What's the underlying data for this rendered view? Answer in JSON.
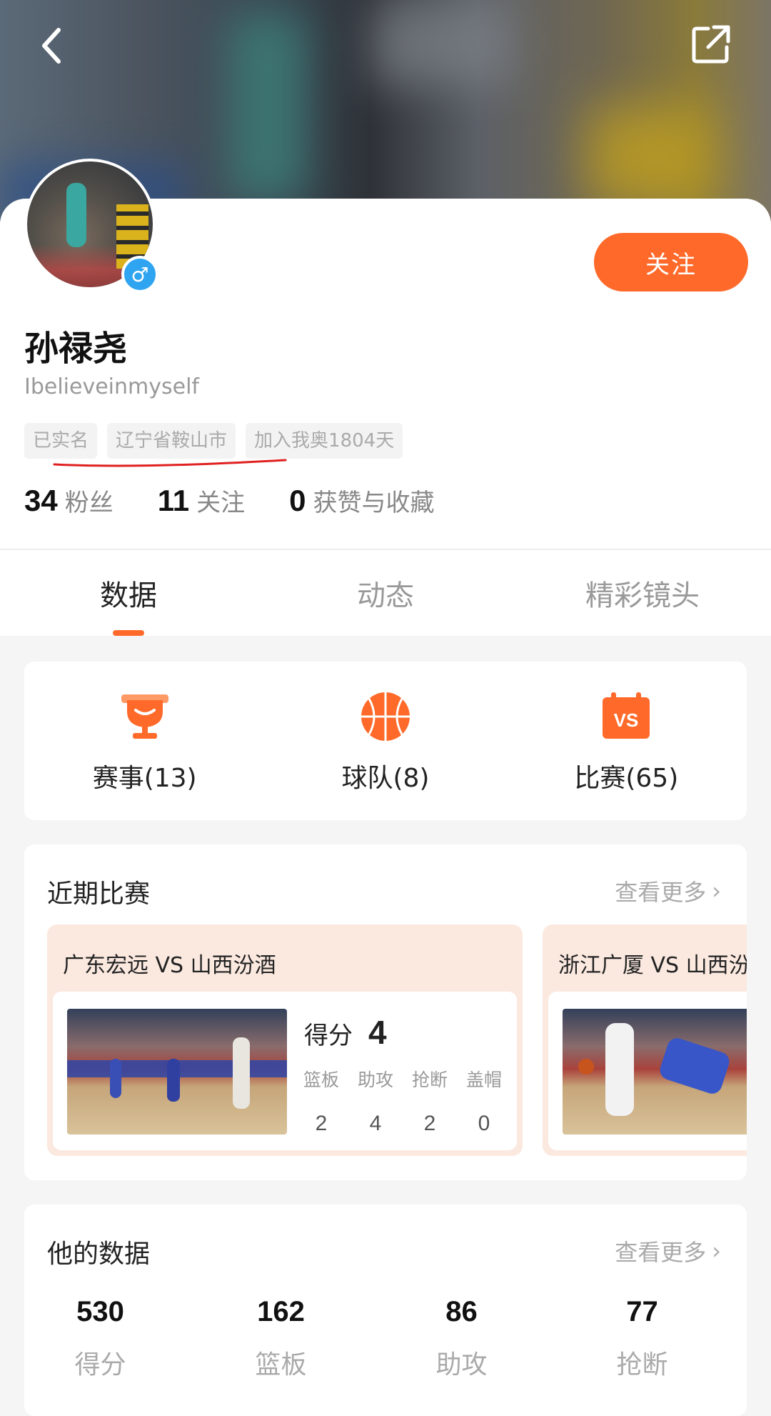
{
  "header": {
    "back_icon": "chevron-left-icon",
    "share_icon": "share-icon"
  },
  "profile": {
    "name": "孙禄尧",
    "handle": "Ibelieveinmyself",
    "gender_symbol": "♂",
    "follow_label": "关注",
    "tags": [
      "已实名",
      "辽宁省鞍山市",
      "加入我奥1804天"
    ],
    "stats": [
      {
        "value": "34",
        "label": "粉丝"
      },
      {
        "value": "11",
        "label": "关注"
      },
      {
        "value": "0",
        "label": "获赞与收藏"
      }
    ]
  },
  "tabs": [
    {
      "label": "数据",
      "active": true
    },
    {
      "label": "动态",
      "active": false
    },
    {
      "label": "精彩镜头",
      "active": false
    }
  ],
  "quick_links": [
    {
      "label": "赛事(13)",
      "icon": "trophy-icon"
    },
    {
      "label": "球队(8)",
      "icon": "basketball-icon"
    },
    {
      "label": "比赛(65)",
      "icon": "vs-calendar-icon"
    }
  ],
  "recent": {
    "title": "近期比赛",
    "see_more": "查看更多",
    "matches": [
      {
        "title": "广东宏远 VS 山西汾酒",
        "score_label": "得分",
        "score": "4",
        "stats": [
          {
            "label": "篮板",
            "value": "2"
          },
          {
            "label": "助攻",
            "value": "4"
          },
          {
            "label": "抢断",
            "value": "2"
          },
          {
            "label": "盖帽",
            "value": "0"
          }
        ]
      },
      {
        "title": "浙江广厦 VS 山西汾酒"
      }
    ]
  },
  "his_data": {
    "title": "他的数据",
    "see_more": "查看更多",
    "items": [
      {
        "value": "530",
        "label": "得分"
      },
      {
        "value": "162",
        "label": "篮板"
      },
      {
        "value": "86",
        "label": "助攻"
      },
      {
        "value": "77",
        "label": "抢断"
      }
    ]
  },
  "colors": {
    "accent": "#ff6a2a",
    "gender": "#2fa4f0",
    "match_bg": "#fbe9e0"
  }
}
